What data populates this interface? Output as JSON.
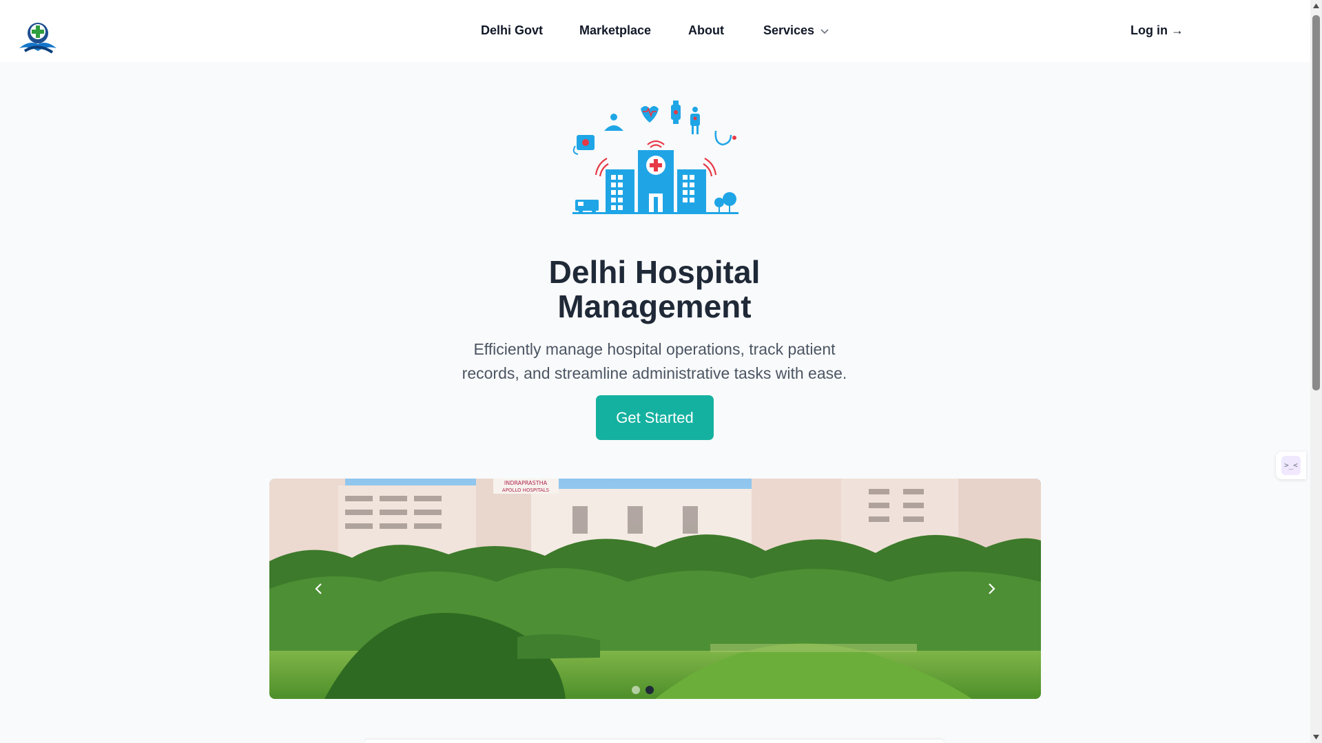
{
  "header": {
    "nav": {
      "delhi_govt": "Delhi Govt",
      "marketplace": "Marketplace",
      "about": "About",
      "services": "Services",
      "login": "Log in →"
    }
  },
  "hero": {
    "title_line1": "Delhi Hospital",
    "title_line2": "Management",
    "subtitle_line1": "Efficiently manage hospital operations, track patient",
    "subtitle_line2": "records, and streamline administrative tasks with ease.",
    "cta_label": "Get Started",
    "accent_color": "#14b1a0"
  },
  "carousel": {
    "slide_count": 2,
    "active_index": 1,
    "sign_text_1": "INDRAPRASTHA",
    "sign_text_2": "APOLLO HOSPITALS"
  },
  "widget": {
    "label": ">_<"
  },
  "icons": [
    "hospital-logo-icon",
    "chevron-down-icon",
    "chevron-left-icon",
    "chevron-right-icon",
    "scroll-up-icon",
    "scroll-down-icon"
  ]
}
